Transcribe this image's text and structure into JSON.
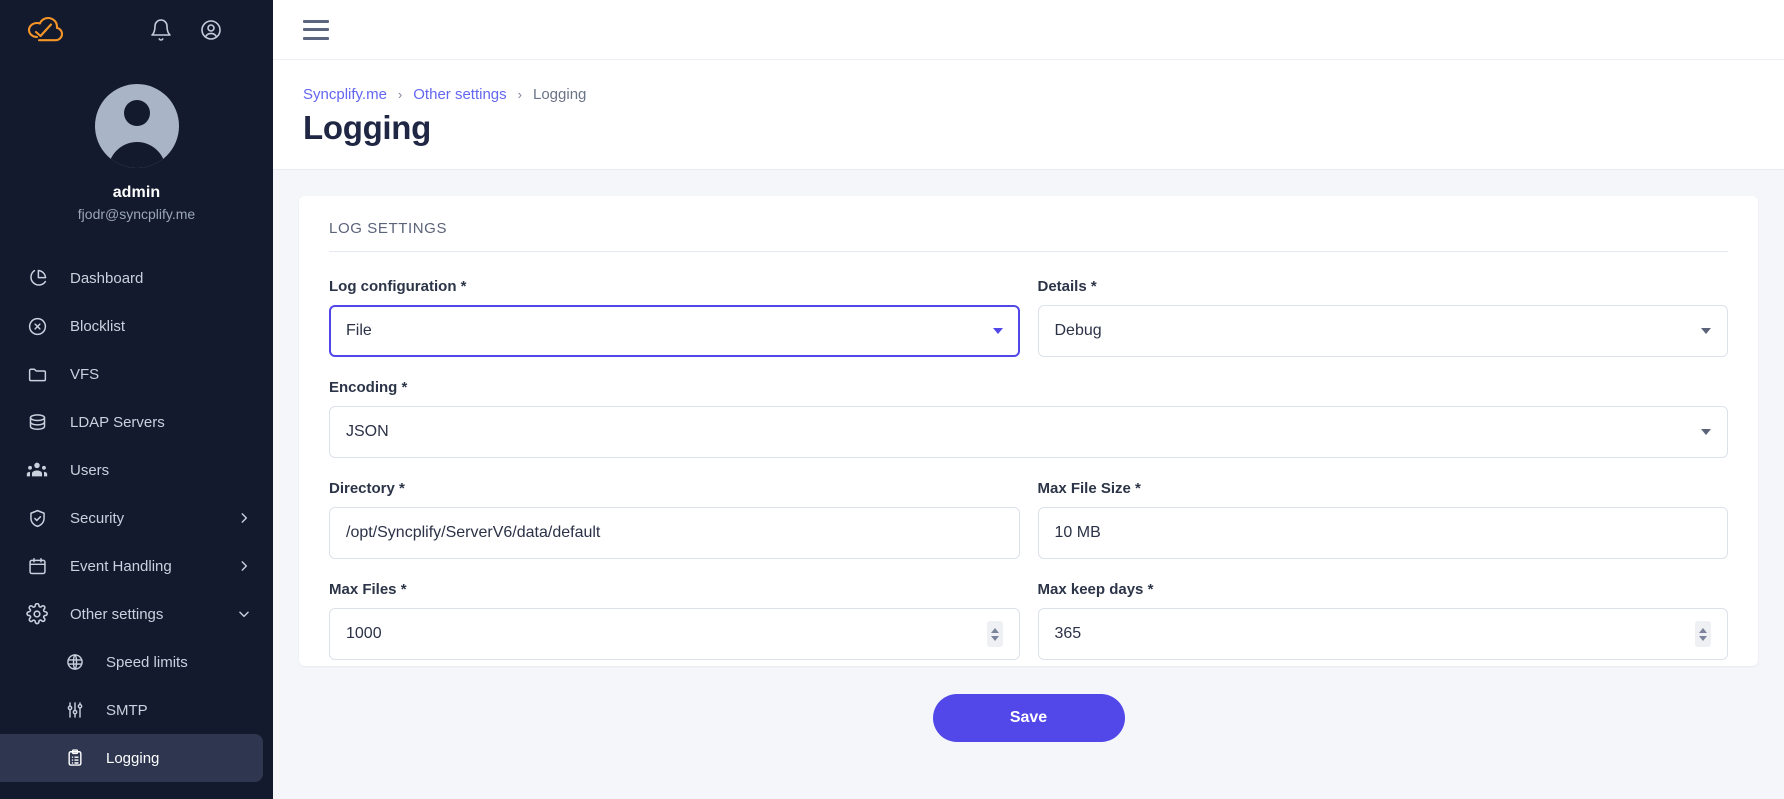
{
  "sidebar": {
    "logo_icon": "syncplify-cloud-logo",
    "top_actions": [
      {
        "name": "notifications-bell-icon",
        "icon": "bell-icon"
      },
      {
        "name": "account-circle-icon",
        "icon": "user-circle-icon"
      }
    ],
    "profile": {
      "avatar_icon": "user-avatar",
      "name": "admin",
      "email": "fjodr@syncplify.me"
    },
    "items": [
      {
        "label": "Dashboard",
        "icon": "pie-chart-icon",
        "expandable": false,
        "active": false,
        "sub": false
      },
      {
        "label": "Blocklist",
        "icon": "x-circle-icon",
        "expandable": false,
        "active": false,
        "sub": false
      },
      {
        "label": "VFS",
        "icon": "folder-icon",
        "expandable": false,
        "active": false,
        "sub": false
      },
      {
        "label": "LDAP Servers",
        "icon": "database-icon",
        "expandable": false,
        "active": false,
        "sub": false
      },
      {
        "label": "Users",
        "icon": "users-icon",
        "expandable": false,
        "active": false,
        "sub": false
      },
      {
        "label": "Security",
        "icon": "shield-check-icon",
        "expandable": true,
        "expanded": false,
        "active": false,
        "sub": false
      },
      {
        "label": "Event Handling",
        "icon": "calendar-icon",
        "expandable": true,
        "expanded": false,
        "active": false,
        "sub": false
      },
      {
        "label": "Other settings",
        "icon": "gear-icon",
        "expandable": true,
        "expanded": true,
        "active": false,
        "sub": false
      },
      {
        "label": "Speed limits",
        "icon": "globe-gauge-icon",
        "expandable": false,
        "active": false,
        "sub": true
      },
      {
        "label": "SMTP",
        "icon": "sliders-icon",
        "expandable": false,
        "active": false,
        "sub": true
      },
      {
        "label": "Logging",
        "icon": "clipboard-list-icon",
        "expandable": false,
        "active": true,
        "sub": true
      }
    ]
  },
  "topbar": {
    "menu_icon": "hamburger-menu-icon"
  },
  "header": {
    "breadcrumb": [
      {
        "label": "Syncplify.me",
        "type": "link"
      },
      {
        "label": "Other settings",
        "type": "link"
      },
      {
        "label": "Logging",
        "type": "current"
      }
    ],
    "breadcrumb_separator": "›",
    "title": "Logging"
  },
  "card": {
    "section_title": "LOG SETTINGS",
    "fields": {
      "log_configuration": {
        "label": "Log configuration",
        "required_marker": "*",
        "value": "File",
        "type": "select",
        "focused": true
      },
      "details": {
        "label": "Details",
        "required_marker": "*",
        "value": "Debug",
        "type": "select",
        "focused": false
      },
      "encoding": {
        "label": "Encoding",
        "required_marker": "*",
        "value": "JSON",
        "type": "select",
        "focused": false
      },
      "directory": {
        "label": "Directory",
        "required_marker": "*",
        "value": "/opt/Syncplify/ServerV6/data/default",
        "type": "text",
        "focused": false
      },
      "max_file_size": {
        "label": "Max File Size",
        "required_marker": "*",
        "value": "10 MB",
        "type": "text",
        "focused": false
      },
      "max_files": {
        "label": "Max Files",
        "required_marker": "*",
        "value": "1000",
        "type": "number",
        "focused": false
      },
      "max_keep_days": {
        "label": "Max keep days",
        "required_marker": "*",
        "value": "365",
        "type": "number",
        "focused": false
      }
    }
  },
  "actions": {
    "save_label": "Save"
  },
  "colors": {
    "sidebar_bg": "#131a2e",
    "sidebar_active": "#2e3650",
    "accent": "#5247e8",
    "link": "#6366f1",
    "logo_orange": "#f59528",
    "page_bg": "#f4f6fa"
  }
}
